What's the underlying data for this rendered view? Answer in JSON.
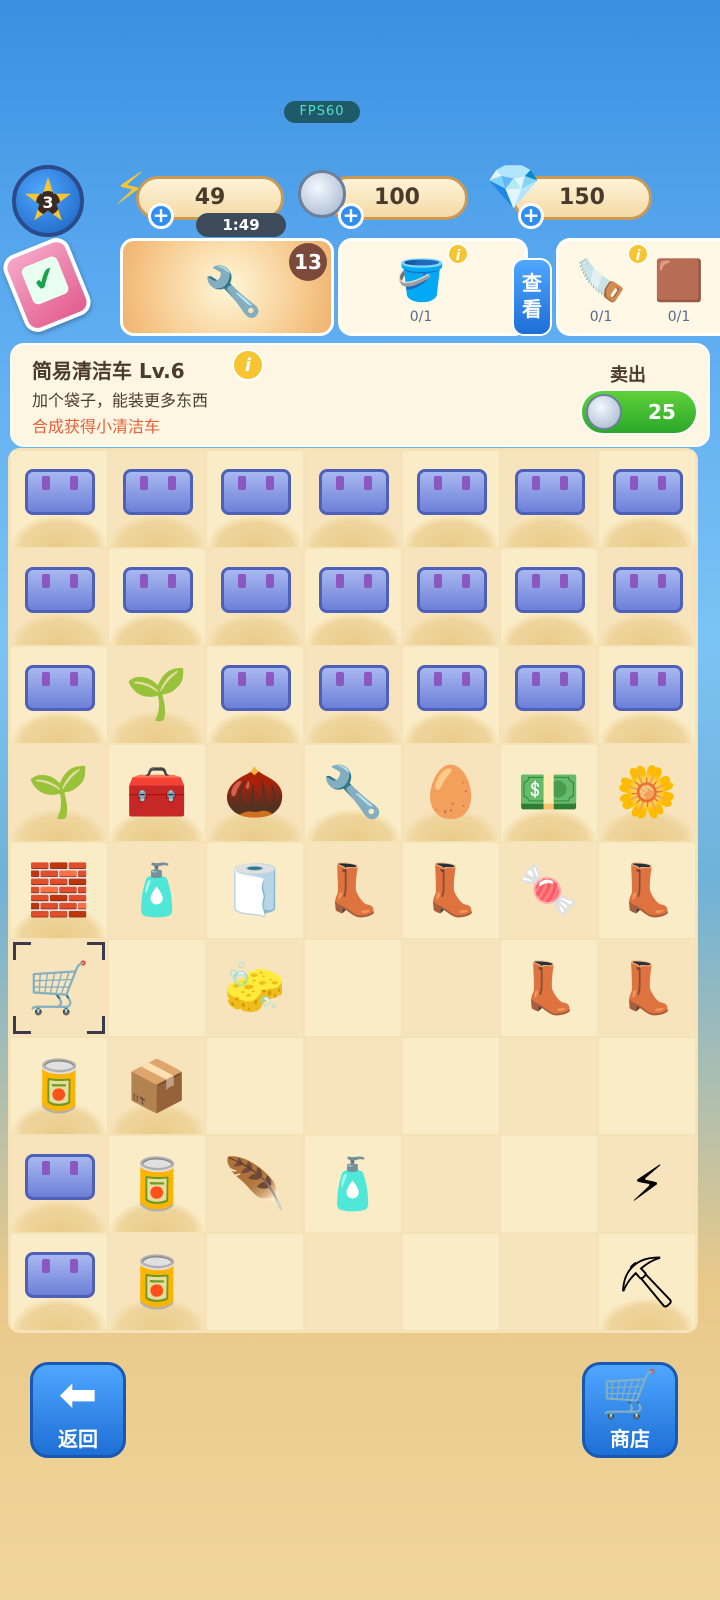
{
  "fps": "FPS60",
  "level": "3",
  "energy": {
    "value": "49",
    "timer": "1:49",
    "icon": "lightning-icon"
  },
  "coins": {
    "value": "100",
    "icon": "coin-icon"
  },
  "gems": {
    "value": "150",
    "icon": "gem-icon"
  },
  "orders": {
    "feature_count": "13",
    "card1": {
      "progress": "0/1",
      "view_label": "查看"
    },
    "card2": {
      "progress_a": "0/1",
      "progress_b": "0/1"
    }
  },
  "info": {
    "title": "简易清洁车  Lv.6",
    "desc": "加个袋子，能装更多东西",
    "hint": "合成获得小清洁车",
    "sell_label": "卖出",
    "sell_value": "25"
  },
  "board": [
    [
      "box",
      "box",
      "box",
      "box",
      "box",
      "box",
      "box"
    ],
    [
      "box",
      "box",
      "box",
      "box",
      "box",
      "box",
      "box"
    ],
    [
      "box",
      "sprout-sand",
      "box",
      "box",
      "box",
      "box",
      "box"
    ],
    [
      "sprout-sand",
      "toolbox",
      "nuts",
      "clamp",
      "tray-eggs",
      "cash",
      "flowers"
    ],
    [
      "trowel",
      "cream-tube",
      "cloth",
      "boots",
      "boot",
      "gumball",
      "boots"
    ],
    [
      "cleaning-cart",
      "",
      "sponge",
      "",
      "",
      "boot",
      "boot"
    ],
    [
      "paint-can-blue",
      "stone-box",
      "",
      "",
      "",
      "",
      ""
    ],
    [
      "box",
      "tin-can",
      "duster",
      "cream-tube",
      "",
      "",
      "energy-orb"
    ],
    [
      "box",
      "paint-can-yellow",
      "",
      "",
      "",
      "",
      "shovel-sand"
    ]
  ],
  "buttons": {
    "back_label": "返回",
    "shop_label": "商店"
  }
}
